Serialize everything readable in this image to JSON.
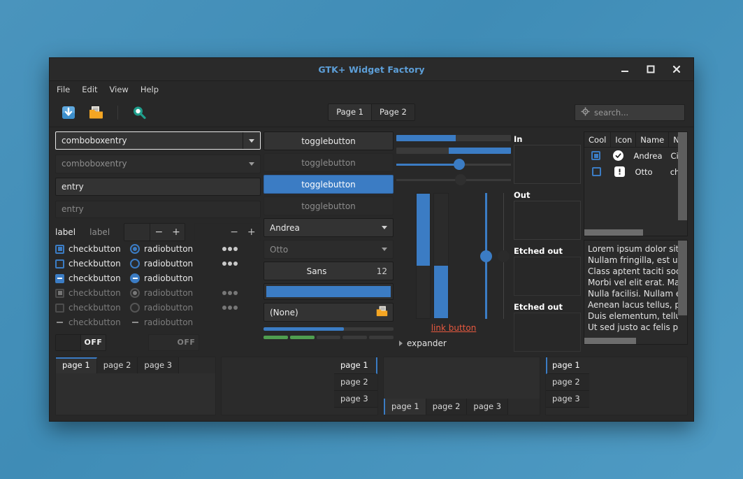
{
  "window": {
    "title": "GTK+ Widget Factory",
    "controls": {
      "minimize": "minimize-icon",
      "maximize": "maximize-icon",
      "close": "close-icon"
    }
  },
  "menubar": {
    "items": [
      "File",
      "Edit",
      "View",
      "Help"
    ]
  },
  "toolbar": {
    "icons": [
      "download-icon",
      "open-folder-icon",
      "search-magnifier-icon"
    ],
    "stack_switcher": [
      {
        "label": "Page 1",
        "selected": true
      },
      {
        "label": "Page 2",
        "selected": false
      }
    ],
    "search": {
      "placeholder": "search...",
      "value": "",
      "icon": "search-target-icon"
    }
  },
  "column1": {
    "comboboxentry_focused": {
      "value": "comboboxentry"
    },
    "comboboxentry_flat": {
      "value": "comboboxentry"
    },
    "entry_filled": {
      "value": "entry"
    },
    "entry_placeholder": {
      "placeholder": "entry"
    },
    "label_row": {
      "label_active": "label",
      "label_dim": "label",
      "spin_value": "",
      "minus": "−",
      "plus": "+"
    },
    "rows": [
      {
        "check_label": "checkbutton",
        "check_state": "on",
        "radio_label": "radiobutton",
        "radio_state": "on",
        "disabled": false,
        "dots": true,
        "dots_dim": false
      },
      {
        "check_label": "checkbutton",
        "check_state": "off",
        "radio_label": "radiobutton",
        "radio_state": "off",
        "disabled": false,
        "dots": true,
        "dots_dim": false
      },
      {
        "check_label": "checkbutton",
        "check_state": "mixed",
        "radio_label": "radiobutton",
        "radio_state": "mixed",
        "disabled": false,
        "dots": false,
        "dots_dim": false
      },
      {
        "check_label": "checkbutton",
        "check_state": "on",
        "radio_label": "radiobutton",
        "radio_state": "on",
        "disabled": true,
        "dots": true,
        "dots_dim": true
      },
      {
        "check_label": "checkbutton",
        "check_state": "off",
        "radio_label": "radiobutton",
        "radio_state": "off",
        "disabled": true,
        "dots": true,
        "dots_dim": true
      },
      {
        "check_label": "checkbutton",
        "check_state": "dashonly",
        "radio_label": "radiobutton",
        "radio_state": "dashonly",
        "disabled": true,
        "dots": false,
        "dots_dim": true
      }
    ],
    "switches": [
      {
        "state_label": "OFF",
        "disabled": false
      },
      {
        "state_label": "OFF",
        "disabled": true
      }
    ]
  },
  "column2": {
    "toggles": [
      {
        "label": "togglebutton",
        "style": "normal"
      },
      {
        "label": "togglebutton",
        "style": "flat"
      },
      {
        "label": "togglebutton",
        "style": "active"
      },
      {
        "label": "togglebutton",
        "style": "flat"
      }
    ],
    "combo_name": {
      "value": "Andrea"
    },
    "combo_name_flat": {
      "value": "Otto"
    },
    "font_button": {
      "family": "Sans",
      "size": "12"
    },
    "color_button": {
      "color": "#3b7cc4"
    },
    "file_button": {
      "value": "(None)",
      "icon": "open-folder-icon"
    },
    "progress": {
      "value": 62
    },
    "levelbar": {
      "segments": 5,
      "filled": 2
    }
  },
  "column3": {
    "hscale_fill_1": {
      "value": 52
    },
    "hscale_fill_2": {
      "value": 54,
      "inverted": true
    },
    "hslider": {
      "value": 55,
      "disabled": false
    },
    "hslider_disabled": {
      "value": 56,
      "disabled": true
    },
    "vscale_fill_1": {
      "value": 58
    },
    "vscale_fill_2": {
      "value": 42,
      "inverted": true
    },
    "vslider": {
      "value": 50,
      "disabled": false
    },
    "vslider_disabled": {
      "value": 50,
      "disabled": true
    },
    "link_button": {
      "label": "link button"
    },
    "expander": {
      "label": "expander",
      "expanded": false
    }
  },
  "column4": {
    "frames": [
      {
        "title": "In"
      },
      {
        "title": "Out"
      },
      {
        "title": "Etched out"
      },
      {
        "title": "Etched out"
      }
    ]
  },
  "column5": {
    "treeview": {
      "columns": [
        "Cool",
        "Icon",
        "Name",
        "Ni"
      ],
      "rows": [
        {
          "cool": "on",
          "icon": "check-circle-icon",
          "name": "Andrea",
          "nick": "Ci"
        },
        {
          "cool": "off",
          "icon": "warning-square-icon",
          "name": "Otto",
          "nick": "ch"
        }
      ]
    },
    "textview": {
      "lines": [
        "Lorem ipsum dolor sit a",
        "Nullam fringilla, est ut",
        "Class aptent taciti socio",
        "Morbi vel elit erat. Mae",
        "Nulla facilisi. Nullam el",
        "Aenean lacus tellus, pe",
        "Duis elementum, tellus",
        "Ut sed justo ac felis pla"
      ]
    }
  },
  "bottom_notebooks": [
    {
      "name": "notebook-tabs-top",
      "position": "top",
      "tabs": [
        {
          "label": "page 1",
          "selected": true
        },
        {
          "label": "page 2",
          "selected": false
        },
        {
          "label": "page 3",
          "selected": false
        }
      ]
    },
    {
      "name": "notebook-tabs-right",
      "position": "right",
      "tabs": [
        {
          "label": "page 1",
          "selected": true
        },
        {
          "label": "page 2",
          "selected": false
        },
        {
          "label": "page 3",
          "selected": false
        }
      ]
    },
    {
      "name": "notebook-tabs-bottom",
      "position": "bottom",
      "tabs": [
        {
          "label": "page 1",
          "selected": true
        },
        {
          "label": "page 2",
          "selected": false
        },
        {
          "label": "page 3",
          "selected": false
        }
      ]
    },
    {
      "name": "notebook-tabs-left",
      "position": "left",
      "tabs": [
        {
          "label": "page 1",
          "selected": true
        },
        {
          "label": "page 2",
          "selected": false
        },
        {
          "label": "page 3",
          "selected": false
        }
      ]
    }
  ],
  "colors": {
    "accent": "#3b7cc4",
    "title": "#5d9fd8",
    "link": "#e8593f",
    "level_green": "#4f9e4f",
    "desktop": "#4a94bd",
    "window_bg": "#282828"
  }
}
